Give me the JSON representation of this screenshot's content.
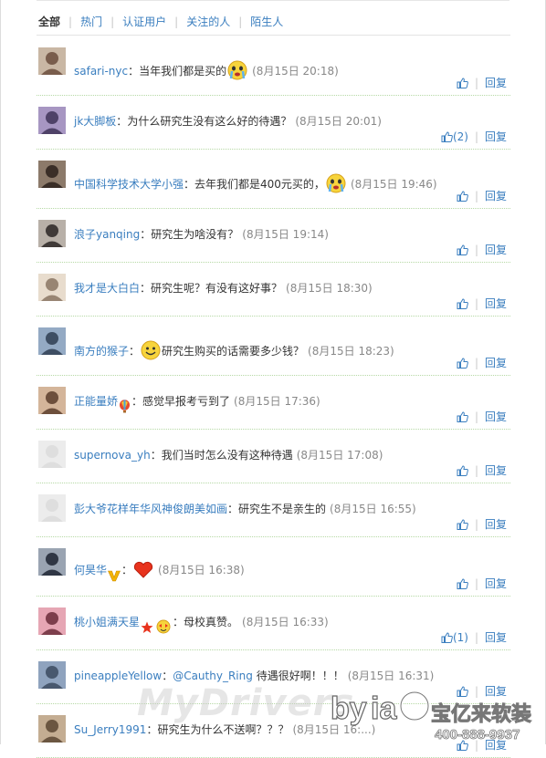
{
  "tabs": [
    {
      "label": "全部",
      "active": true
    },
    {
      "label": "热门",
      "active": false
    },
    {
      "label": "认证用户",
      "active": false
    },
    {
      "label": "关注的人",
      "active": false
    },
    {
      "label": "陌生人",
      "active": false
    }
  ],
  "reply_label": "回复",
  "comments": [
    {
      "user": "safari-nyc",
      "text": "当年我们都是买的",
      "emoticon": "cry-face-icon",
      "time": "(8月15日 20:18)",
      "likes": ""
    },
    {
      "user": "jk大脚板",
      "text": "为什么研究生没有这么好的待遇？",
      "time": "(8月15日 20:01)",
      "likes": "(2)"
    },
    {
      "user": "中国科学技术大学小强",
      "text": "去年我们都是400元买的，",
      "emoticon": "cry-face-icon",
      "time": "(8月15日 19:46)",
      "likes": ""
    },
    {
      "user": "浪子yanqing",
      "text": "研究生为啥没有？",
      "time": "(8月15日 19:14)",
      "likes": ""
    },
    {
      "user": "我才是大白白",
      "text": "研究生呢？有没有这好事？",
      "time": "(8月15日 18:30)",
      "likes": ""
    },
    {
      "user": "南方的猴子",
      "emoticon_before": "smile-face-icon",
      "text": "研究生购买的话需要多少钱？",
      "time": "(8月15日 18:23)",
      "likes": ""
    },
    {
      "user": "正能量娇",
      "badge": "balloon-badge-icon",
      "text": "感觉早报考亏到了",
      "time": "(8月15日 17:36)",
      "likes": ""
    },
    {
      "user": "supernova_yh",
      "text": "我们当时怎么没有这种待遇",
      "time": "(8月15日 17:08)",
      "likes": ""
    },
    {
      "user": "彭大爷花样年华风神俊朗美如画",
      "text": "研究生不是亲生的",
      "time": "(8月15日 16:55)",
      "likes": ""
    },
    {
      "user": "何昊华",
      "badge": "verified-v-icon",
      "emoticon_before": "heart-icon",
      "text": "",
      "time": "(8月15日 16:38)",
      "likes": ""
    },
    {
      "user": "桃小姐满天星",
      "badge": "star-badge-icon",
      "text": "母校真赞。",
      "time": "(8月15日 16:33)",
      "likes": "(1)"
    },
    {
      "user": "pineappleYellow",
      "mention": "@Cauthy_Ring",
      "text": "待遇很好啊！！！",
      "time": "(8月15日 16:31)",
      "likes": ""
    },
    {
      "user": "Su_Jerry1991",
      "text": "研究生为什么不送啊？？？",
      "time": "(8月15日 16:...)",
      "likes": ""
    }
  ],
  "watermark": "MyDrivers",
  "logo": {
    "brand": "by ia b",
    "cn": "宝亿来软装",
    "phone": "400-888-9937"
  },
  "colors": {
    "link": "#3a7ebf",
    "divider": "#b6d9a5",
    "time": "#888888"
  }
}
